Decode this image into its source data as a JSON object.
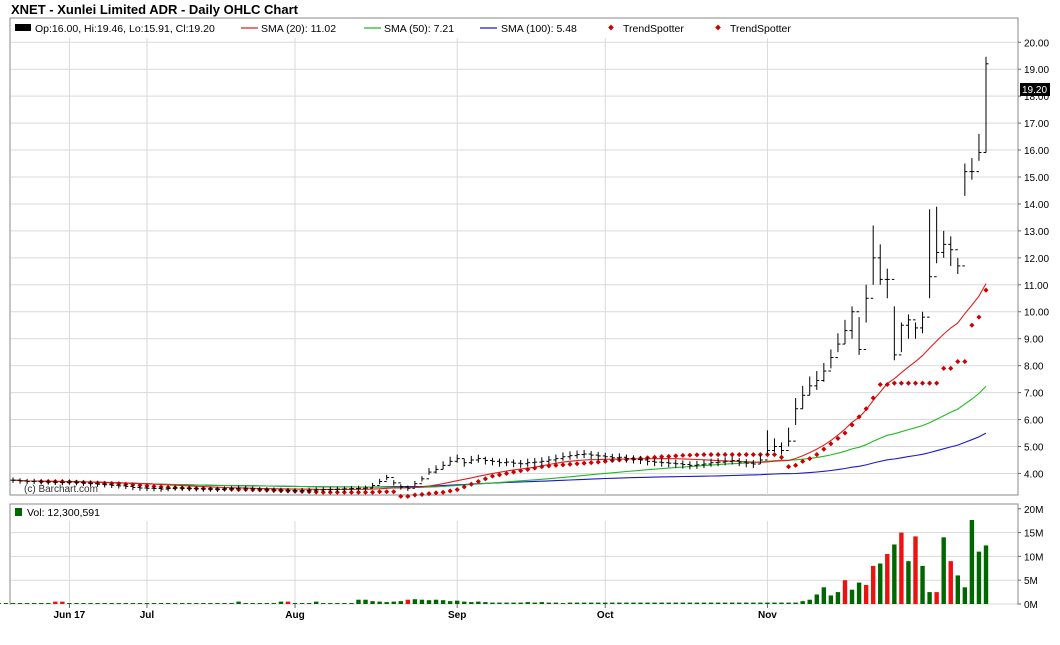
{
  "title": "XNET - Xunlei Limited ADR - Daily OHLC Chart",
  "watermark": "(c) Barchart.com",
  "colors": {
    "ohlc": "#000000",
    "sma20": "#e02020",
    "sma50": "#22bb22",
    "sma100": "#1a1acc",
    "trendspotter": "#cc0000",
    "vol_up": "#006600",
    "vol_down": "#ee1111",
    "grid": "#d9d9d9"
  },
  "legend": {
    "ohlc": "Op:16.00, Hi:19.46, Lo:15.91, Cl:19.20",
    "sma20": "SMA (20): 11.02",
    "sma50": "SMA (50): 7.21",
    "sma100": "SMA (100): 5.48",
    "trend1": "TrendSpotter",
    "trend2": "TrendSpotter"
  },
  "volume_legend": "Vol: 12,300,591",
  "last_price_label": "19.20",
  "chart_data": [
    {
      "type": "ohlc",
      "title": "XNET - Xunlei Limited ADR - Daily OHLC Chart",
      "x_type": "date",
      "x_range": [
        "2017-06-06",
        "2017-11-17"
      ],
      "x_tick_labels": [
        "Jun 17",
        "Jul",
        "Aug",
        "Sep",
        "Oct",
        "Nov"
      ],
      "x_ticks": [
        "2017-06-16",
        "2017-07-03",
        "2017-08-01",
        "2017-09-01",
        "2017-10-02",
        "2017-11-01"
      ],
      "ylim": [
        3.2,
        20.9
      ],
      "y_tick_labels": [
        "4.00",
        "5.00",
        "6.00",
        "7.00",
        "8.00",
        "9.00",
        "10.00",
        "11.00",
        "12.00",
        "13.00",
        "14.00",
        "15.00",
        "16.00",
        "17.00",
        "18.00",
        "19.00",
        "20.00"
      ],
      "y_ticks": [
        4,
        5,
        6,
        7,
        8,
        9,
        10,
        11,
        12,
        13,
        14,
        15,
        16,
        17,
        18,
        19,
        20
      ],
      "grid": true,
      "legend_position": "top",
      "series": [
        {
          "name": "XNET",
          "type": "ohlc",
          "x_weeks_from_start": "see script (trading days)",
          "close": [
            3.75,
            3.72,
            3.7,
            3.71,
            3.69,
            3.68,
            3.67,
            3.66,
            3.68,
            3.66,
            3.64,
            3.62,
            3.6,
            3.58,
            3.56,
            3.54,
            3.52,
            3.48,
            3.46,
            3.45,
            3.44,
            3.42,
            3.44,
            3.46,
            3.45,
            3.44,
            3.43,
            3.42,
            3.42,
            3.41,
            3.43,
            3.44,
            3.46,
            3.45,
            3.43,
            3.41,
            3.4,
            3.39,
            3.38,
            3.37,
            3.36,
            3.37,
            3.38,
            3.39,
            3.4,
            3.41,
            3.42,
            3.43,
            3.44,
            3.45,
            3.46,
            3.55,
            3.7,
            3.85,
            3.65,
            3.5,
            3.45,
            3.62,
            3.8,
            4.05,
            4.15,
            4.3,
            4.45,
            4.55,
            4.4,
            4.5,
            4.55,
            4.48,
            4.45,
            4.4,
            4.42,
            4.38,
            4.36,
            4.4,
            4.42,
            4.45,
            4.5,
            4.55,
            4.62,
            4.66,
            4.7,
            4.72,
            4.68,
            4.65,
            4.62,
            4.58,
            4.6,
            4.55,
            4.52,
            4.5,
            4.45,
            4.42,
            4.4,
            4.38,
            4.36,
            4.33,
            4.3,
            4.32,
            4.35,
            4.4,
            4.42,
            4.45,
            4.48,
            4.42,
            4.38,
            4.35,
            4.5,
            4.85,
            5.0,
            4.85,
            5.2,
            6.4,
            6.9,
            7.25,
            7.45,
            7.8,
            8.3,
            8.8,
            9.3,
            10.0,
            8.6,
            10.5,
            12.0,
            11.2,
            11.2,
            8.4,
            9.5,
            9.7,
            9.4,
            9.8,
            11.3,
            12.2,
            12.5,
            12.3,
            11.7,
            15.2,
            15.2,
            15.91,
            19.2
          ],
          "high": [
            3.85,
            3.82,
            3.8,
            3.8,
            3.78,
            3.77,
            3.76,
            3.75,
            3.77,
            3.75,
            3.73,
            3.71,
            3.69,
            3.67,
            3.65,
            3.63,
            3.61,
            3.58,
            3.55,
            3.54,
            3.53,
            3.51,
            3.53,
            3.55,
            3.54,
            3.53,
            3.52,
            3.51,
            3.51,
            3.5,
            3.52,
            3.53,
            3.55,
            3.54,
            3.52,
            3.5,
            3.49,
            3.48,
            3.47,
            3.46,
            3.45,
            3.46,
            3.47,
            3.48,
            3.49,
            3.5,
            3.51,
            3.52,
            3.53,
            3.54,
            3.55,
            3.65,
            3.8,
            3.95,
            3.75,
            3.6,
            3.55,
            3.72,
            3.9,
            4.2,
            4.3,
            4.45,
            4.62,
            4.7,
            4.55,
            4.65,
            4.7,
            4.62,
            4.58,
            4.55,
            4.56,
            4.52,
            4.5,
            4.55,
            4.57,
            4.6,
            4.65,
            4.7,
            4.78,
            4.82,
            4.85,
            4.87,
            4.83,
            4.8,
            4.77,
            4.73,
            4.75,
            4.7,
            4.67,
            4.65,
            4.6,
            4.57,
            4.55,
            4.53,
            4.51,
            4.48,
            4.45,
            4.47,
            4.5,
            4.55,
            4.57,
            4.6,
            4.63,
            4.57,
            4.53,
            4.5,
            4.7,
            5.6,
            5.3,
            5.15,
            5.7,
            6.8,
            7.25,
            7.6,
            7.8,
            8.1,
            8.6,
            9.2,
            9.7,
            10.2,
            9.8,
            11.0,
            13.2,
            12.5,
            11.6,
            10.2,
            9.6,
            9.9,
            9.6,
            10.0,
            13.8,
            13.9,
            13.0,
            12.8,
            12.0,
            15.5,
            15.7,
            16.6,
            19.46
          ],
          "low": [
            3.65,
            3.62,
            3.6,
            3.61,
            3.59,
            3.58,
            3.57,
            3.56,
            3.58,
            3.56,
            3.54,
            3.52,
            3.5,
            3.48,
            3.46,
            3.44,
            3.42,
            3.38,
            3.36,
            3.35,
            3.34,
            3.32,
            3.34,
            3.36,
            3.35,
            3.34,
            3.33,
            3.32,
            3.32,
            3.31,
            3.33,
            3.34,
            3.36,
            3.35,
            3.33,
            3.31,
            3.3,
            3.29,
            3.28,
            3.27,
            3.26,
            3.27,
            3.28,
            3.29,
            3.3,
            3.31,
            3.32,
            3.33,
            3.34,
            3.35,
            3.36,
            3.45,
            3.6,
            3.75,
            3.55,
            3.4,
            3.35,
            3.52,
            3.7,
            3.95,
            4.0,
            4.15,
            4.3,
            4.4,
            4.25,
            4.35,
            4.4,
            4.33,
            4.3,
            4.25,
            4.27,
            4.23,
            4.21,
            4.25,
            4.27,
            4.3,
            4.35,
            4.4,
            4.47,
            4.51,
            4.55,
            4.57,
            4.53,
            4.5,
            4.47,
            4.43,
            4.45,
            4.4,
            4.37,
            4.35,
            4.3,
            4.27,
            4.25,
            4.23,
            4.21,
            4.18,
            4.15,
            4.17,
            4.2,
            4.25,
            4.27,
            4.3,
            4.33,
            4.27,
            4.23,
            4.2,
            4.35,
            4.7,
            4.8,
            4.7,
            5.0,
            5.8,
            6.4,
            6.9,
            7.1,
            7.4,
            7.9,
            8.5,
            8.8,
            9.0,
            8.4,
            9.6,
            11.0,
            11.0,
            10.5,
            8.2,
            8.5,
            9.0,
            9.0,
            9.2,
            10.5,
            11.8,
            12.0,
            11.7,
            11.4,
            14.3,
            14.9,
            15.6,
            15.91
          ]
        },
        {
          "name": "SMA (20)",
          "last": 11.02
        },
        {
          "name": "SMA (50)",
          "last": 7.21
        },
        {
          "name": "SMA (100)",
          "last": 5.48
        },
        {
          "name": "TrendSpotter",
          "values": [
            3.7,
            3.7,
            3.7,
            3.7,
            3.69,
            3.68,
            3.67,
            3.66,
            3.65,
            3.64,
            3.63,
            3.62,
            3.6,
            3.58,
            3.56,
            3.54,
            3.52,
            3.5,
            3.48,
            3.47,
            3.46,
            3.45,
            3.44,
            3.44,
            3.43,
            3.42,
            3.42,
            3.41,
            3.4,
            3.4,
            3.39,
            3.39,
            3.38,
            3.37,
            3.36,
            3.35,
            3.34,
            3.33,
            3.32,
            3.31,
            3.3,
            3.3,
            3.3,
            3.3,
            3.3,
            3.3,
            3.3,
            3.3,
            3.32,
            3.32,
            3.32,
            3.15,
            3.15,
            3.2,
            3.22,
            3.25,
            3.28,
            3.3,
            3.35,
            3.4,
            3.5,
            3.6,
            3.7,
            3.8,
            3.9,
            3.95,
            4.0,
            4.05,
            4.1,
            4.15,
            4.2,
            4.25,
            4.28,
            4.3,
            4.32,
            4.34,
            4.36,
            4.38,
            4.4,
            4.42,
            4.45,
            4.48,
            4.5,
            4.52,
            4.54,
            4.56,
            4.58,
            4.6,
            4.62,
            4.63,
            4.65,
            4.67,
            4.68,
            4.69,
            4.7,
            4.7,
            4.7,
            4.7,
            4.7,
            4.7,
            4.7,
            4.7,
            4.7,
            4.7,
            4.7,
            4.6,
            4.25,
            4.3,
            4.45,
            4.55,
            4.7,
            4.9,
            5.1,
            5.3,
            5.5,
            5.8,
            6.1,
            6.4,
            6.8,
            7.3,
            7.3,
            7.35,
            7.35,
            7.35,
            7.35,
            7.35,
            7.35,
            7.35,
            7.9,
            7.9,
            8.15,
            8.15,
            9.5,
            9.8,
            10.8
          ]
        }
      ],
      "volume": {
        "title": "Vol: 12,300,591",
        "ylim": [
          0,
          21000000
        ],
        "y_tick_labels": [
          "0M",
          "5M",
          "10M",
          "15M",
          "20M"
        ],
        "y_ticks": [
          0,
          5000000,
          10000000,
          15000000,
          20000000
        ],
        "values_millions": [
          0.2,
          0.2,
          0.2,
          0.2,
          0.2,
          0.2,
          0.2,
          0.2,
          0.5,
          0.5,
          0.2,
          0.2,
          0.2,
          0.2,
          0.2,
          0.2,
          0.2,
          0.2,
          0.2,
          0.2,
          0.2,
          0.2,
          0.2,
          0.2,
          0.2,
          0.2,
          0.2,
          0.2,
          0.2,
          0.2,
          0.2,
          0.2,
          0.2,
          0.2,
          0.5,
          0.2,
          0.2,
          0.2,
          0.2,
          0.2,
          0.5,
          0.5,
          0.2,
          0.2,
          0.2,
          0.5,
          0.2,
          0.2,
          0.2,
          0.2,
          0.2,
          0.9,
          0.9,
          0.6,
          0.5,
          0.4,
          0.5,
          0.6,
          0.9,
          1.0,
          0.9,
          0.8,
          0.9,
          0.8,
          0.6,
          0.7,
          0.5,
          0.4,
          0.5,
          0.4,
          0.3,
          0.3,
          0.3,
          0.3,
          0.3,
          0.4,
          0.3,
          0.4,
          0.3,
          0.3,
          0.2,
          0.3,
          0.3,
          0.3,
          0.3,
          0.3,
          0.3,
          0.3,
          0.3,
          0.3,
          0.3,
          0.3,
          0.3,
          0.3,
          0.3,
          0.3,
          0.3,
          0.3,
          0.3,
          0.3,
          0.3,
          0.3,
          0.3,
          0.3,
          0.3,
          0.3,
          0.3,
          0.3,
          0.3,
          0.3,
          0.3,
          0.3,
          0.3,
          0.3,
          0.6,
          0.9,
          2.0,
          3.5,
          1.8,
          2.5,
          5.0,
          3.0,
          4.5,
          4.0,
          8.0,
          8.5,
          10.5,
          12.5,
          15.0,
          9.0,
          14.2,
          8.0,
          2.5,
          2.5,
          14.0,
          9.0,
          6.0,
          3.5,
          19.5,
          11.0,
          12.3
        ],
        "volume_direction": [
          "up",
          "up",
          "up",
          "up",
          "up",
          "up",
          "up",
          "up",
          "down",
          "down",
          "up",
          "up",
          "up",
          "up",
          "up",
          "up",
          "up",
          "up",
          "up",
          "up",
          "up",
          "up",
          "up",
          "up",
          "up",
          "up",
          "up",
          "up",
          "up",
          "up",
          "up",
          "up",
          "up",
          "up",
          "up",
          "up",
          "up",
          "up",
          "up",
          "up",
          "up",
          "down",
          "up",
          "up",
          "up",
          "up",
          "up",
          "up",
          "up",
          "up",
          "up",
          "up",
          "up",
          "up",
          "up",
          "up",
          "up",
          "up",
          "down",
          "up",
          "up",
          "up",
          "up",
          "up",
          "up",
          "up",
          "up",
          "up",
          "up",
          "up",
          "up",
          "up",
          "up",
          "up",
          "up",
          "up",
          "up",
          "up",
          "up",
          "up",
          "up",
          "up",
          "up",
          "up",
          "up",
          "up",
          "up",
          "up",
          "up",
          "up",
          "up",
          "up",
          "up",
          "up",
          "up",
          "up",
          "up",
          "up",
          "up",
          "up",
          "up",
          "up",
          "up",
          "up",
          "up",
          "up",
          "up",
          "up",
          "up",
          "up",
          "up",
          "up",
          "up",
          "up",
          "up",
          "up",
          "up",
          "up",
          "up",
          "up",
          "down",
          "up",
          "up",
          "down",
          "down",
          "up",
          "down",
          "up",
          "down",
          "up",
          "down",
          "up",
          "up",
          "down",
          "up",
          "down",
          "up",
          "up",
          "up"
        ]
      }
    }
  ]
}
